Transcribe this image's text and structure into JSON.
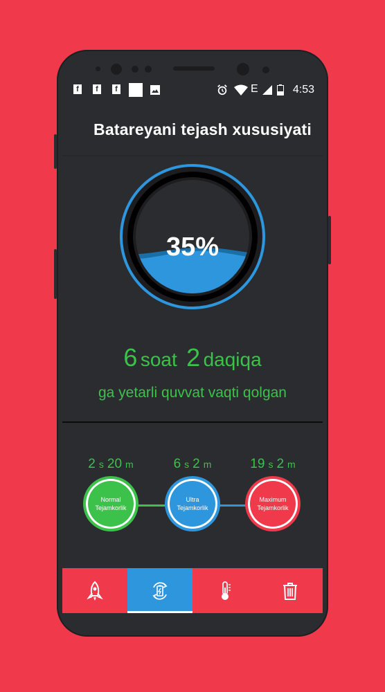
{
  "status_bar": {
    "time": "4:53",
    "left_icons": [
      "facebook-icon",
      "facebook-icon",
      "facebook-icon",
      "blank-square-icon",
      "image-icon"
    ],
    "right_icons": [
      "alarm-icon",
      "wifi-icon",
      "network-e-icon",
      "signal-icon",
      "battery-icon"
    ]
  },
  "header": {
    "title": "Batareyani tejash xususiyati"
  },
  "battery": {
    "percent_label": "35%",
    "level": 0.35
  },
  "remaining": {
    "hours": "6",
    "hours_unit": "soat",
    "minutes": "2",
    "minutes_unit": "daqiqa",
    "subtitle": "ga yetarli quvvat vaqti qolgan"
  },
  "modes": [
    {
      "h": "2",
      "h_unit": "s",
      "m": "20",
      "m_unit": "m",
      "label_line1": "Normal",
      "label_line2": "Tejamkorlik",
      "color": "#3cc24a"
    },
    {
      "h": "6",
      "h_unit": "s",
      "m": "2",
      "m_unit": "m",
      "label_line1": "Ultra",
      "label_line2": "Tejamkorlik",
      "color": "#2d96dc"
    },
    {
      "h": "19",
      "h_unit": "s",
      "m": "2",
      "m_unit": "m",
      "label_line1": "Maximum",
      "label_line2": "Tejamkorlik",
      "color": "#f0394b"
    }
  ],
  "navbar": {
    "items": [
      {
        "icon": "rocket-icon",
        "active": false
      },
      {
        "icon": "battery-saver-icon",
        "active": true
      },
      {
        "icon": "thermometer-icon",
        "active": false
      },
      {
        "icon": "trash-icon",
        "active": false
      }
    ]
  },
  "colors": {
    "background": "#f0394b",
    "phone_body": "#2b2c30",
    "accent_green": "#3cc24a",
    "accent_blue": "#2d96dc",
    "accent_red": "#f0394b"
  }
}
